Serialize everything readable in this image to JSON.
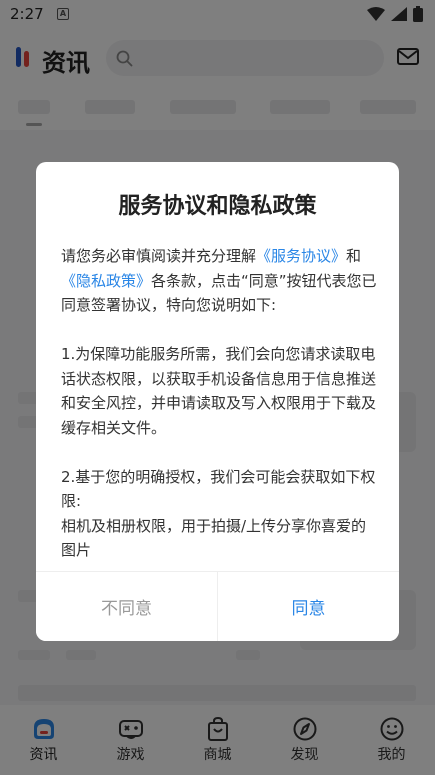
{
  "status_bar": {
    "time": "2:27",
    "notification_badge": "A"
  },
  "header": {
    "title": "资讯",
    "search_placeholder": ""
  },
  "dialog": {
    "title": "服务协议和隐私政策",
    "intro_before": "请您务必审慎阅读并充分理解",
    "link_service": "《服务协议》",
    "intro_and": "和",
    "link_privacy": "《隐私政策》",
    "intro_after": "各条款，点击“同意”按钮代表您已同意签署协议，特向您说明如下:",
    "paragraph_1": "1.为保障功能服务所需，我们会向您请求读取电话状态权限，以获取手机设备信息用于信息推送和安全风控，并申请读取及写入权限用于下载及缓存相关文件。",
    "paragraph_2_line1": "2.基于您的明确授权，我们会可能会获取如下权限:",
    "paragraph_2_line2": "相机及相册权限，用于拍摄/上传分享你喜爱的图片",
    "disagree_label": "不同意",
    "agree_label": "同意"
  },
  "bottom_nav": {
    "items": [
      {
        "label": "资讯",
        "icon": "news-icon"
      },
      {
        "label": "游戏",
        "icon": "gamepad-icon"
      },
      {
        "label": "商城",
        "icon": "shopping-bag-icon"
      },
      {
        "label": "发现",
        "icon": "compass-icon"
      },
      {
        "label": "我的",
        "icon": "smiley-icon"
      }
    ]
  },
  "colors": {
    "accent": "#2a86e6",
    "logo_blue": "#2457c5",
    "logo_red": "#e8453c"
  }
}
